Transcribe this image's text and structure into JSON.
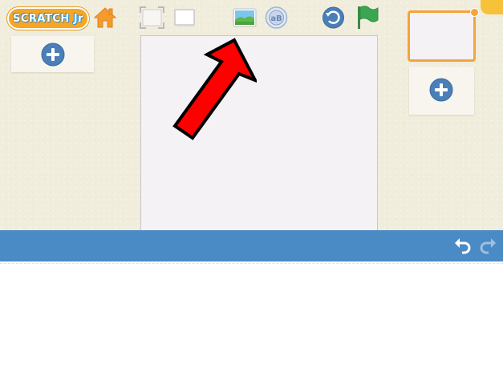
{
  "app": {
    "logo_text": "SCRATCH Jr",
    "logo_color": "#f6a623"
  },
  "toolbar": {
    "icons": [
      "home-icon",
      "fullscreen-icon",
      "presentation-card-icon",
      "background-image-icon",
      "text-tool-icon",
      "reset-icon",
      "green-flag-icon"
    ]
  },
  "colors": {
    "background": "#f1eddc",
    "stage": "#f4f2f5",
    "accent_orange": "#f5a33c",
    "bar_blue": "#4a8ac5",
    "plus_blue": "#4a7fb8",
    "flag_green": "#3aa651",
    "annotation_red": "#ff0000"
  },
  "pages": {
    "count": 1,
    "selected": 1
  },
  "annotation": {
    "type": "arrow",
    "points_to": "background-image-button"
  }
}
